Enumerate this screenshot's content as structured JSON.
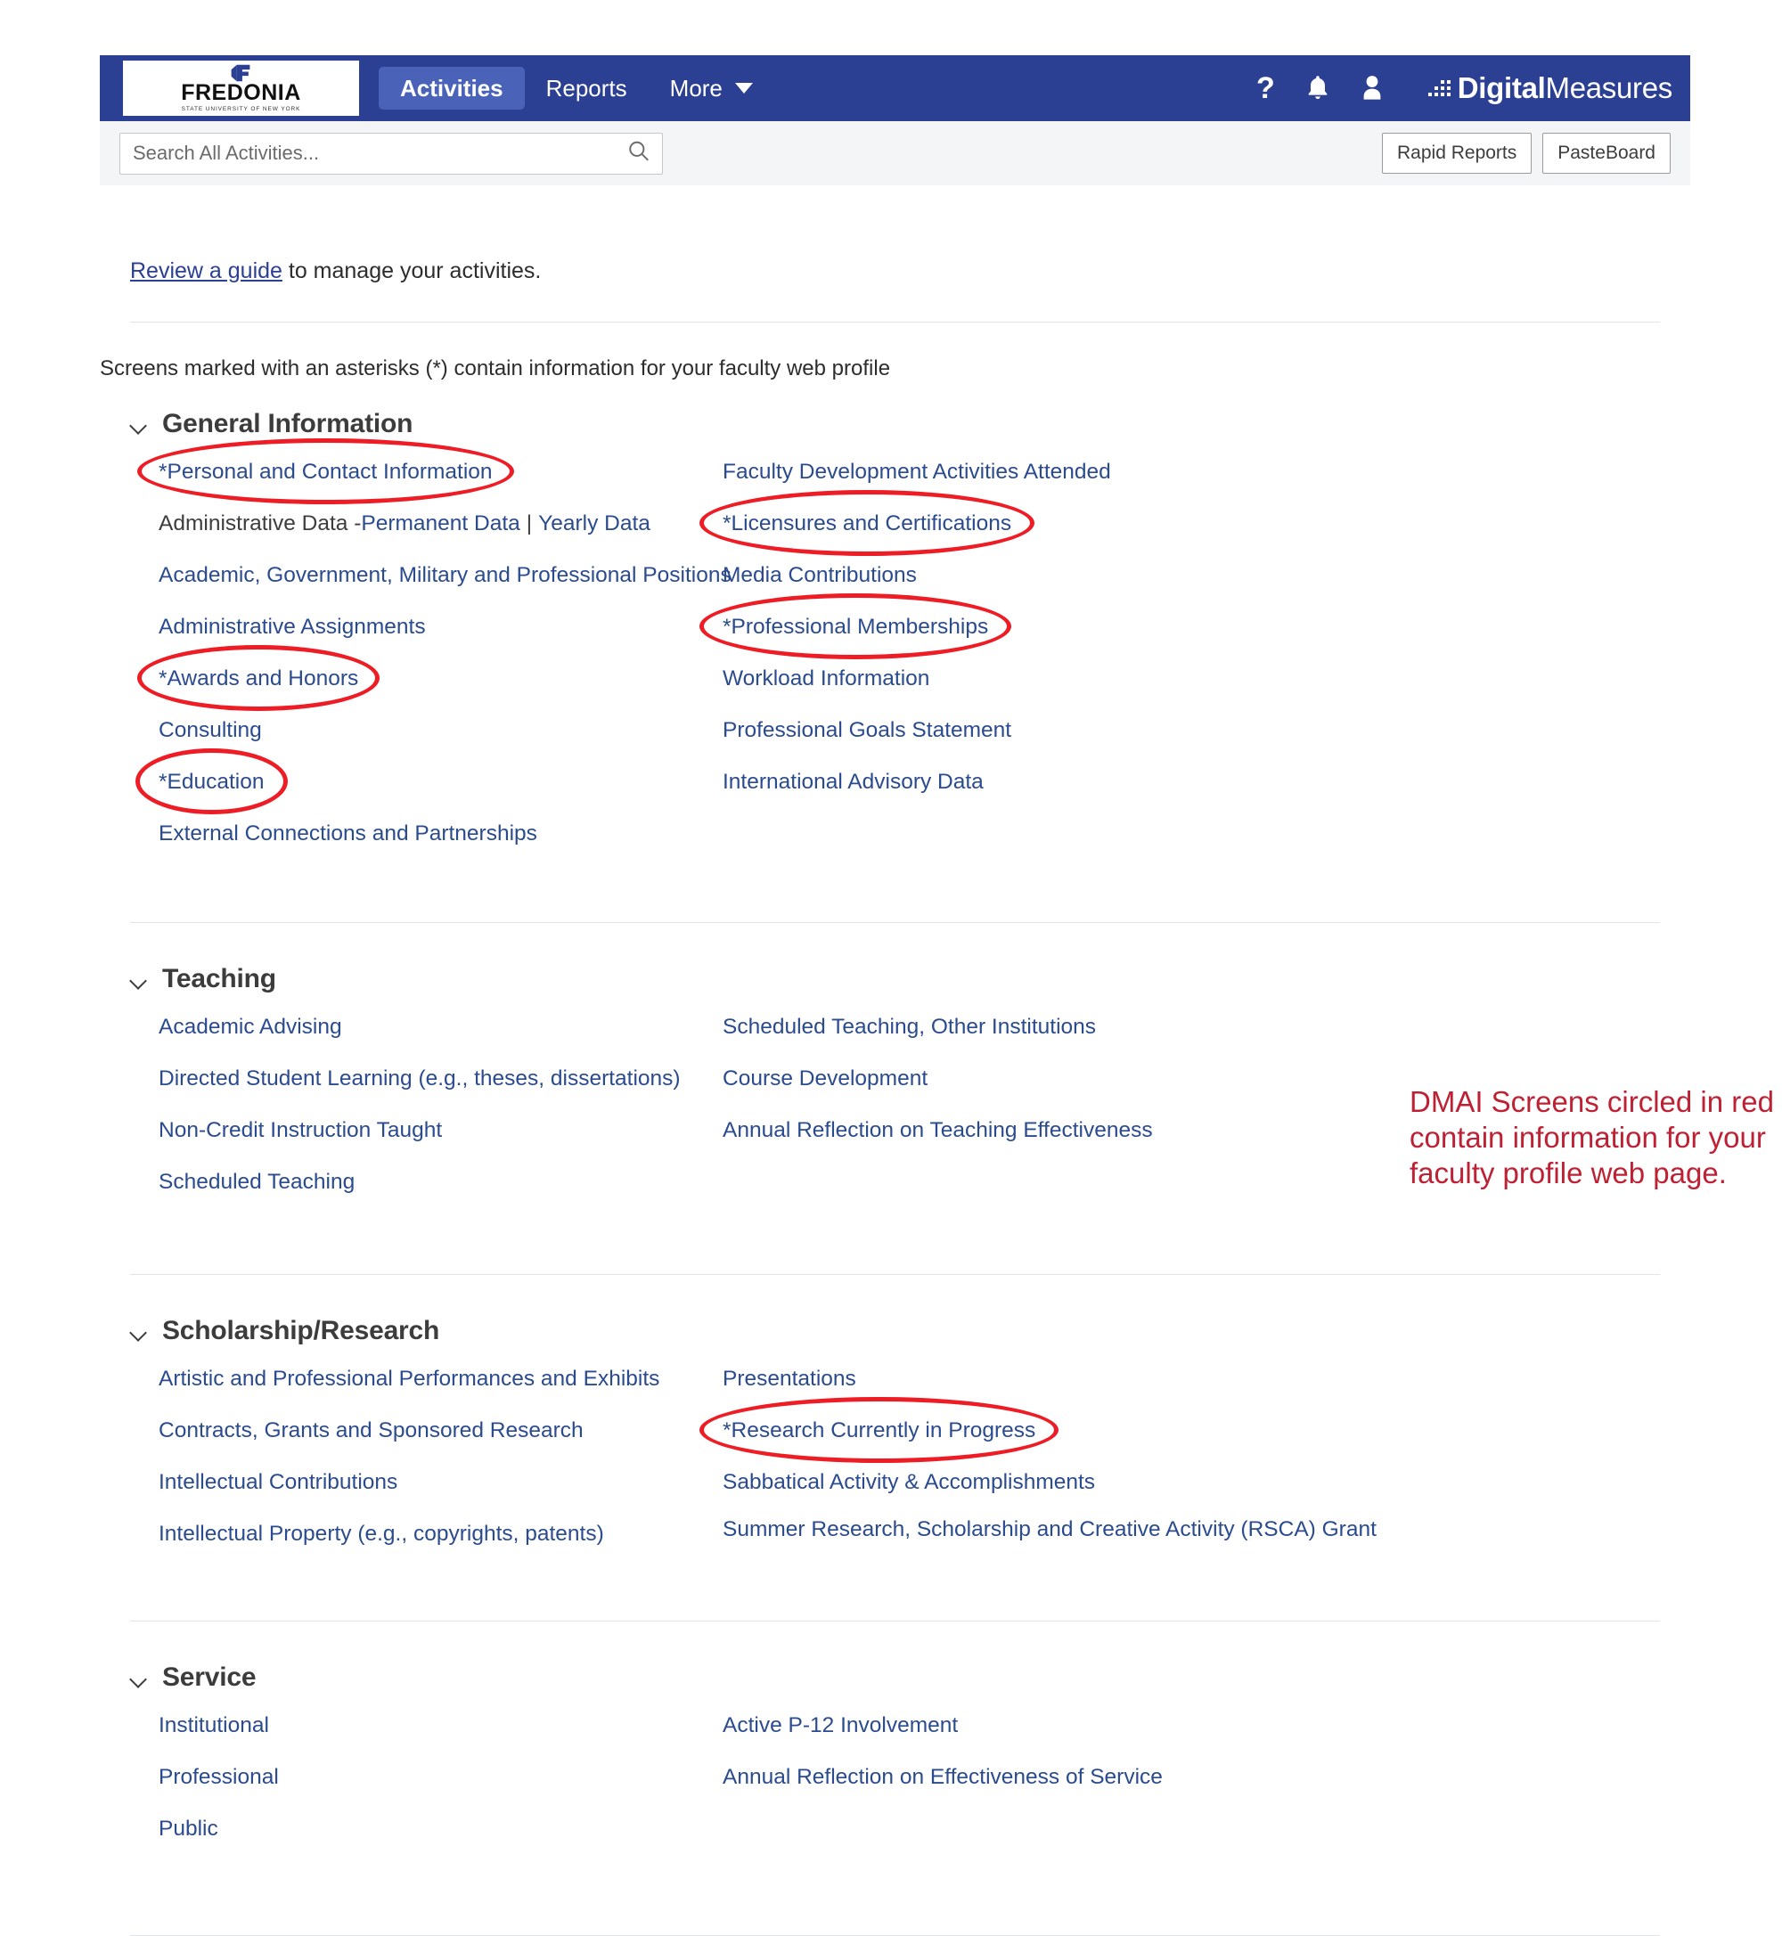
{
  "colors": {
    "nav_blue": "#2b3f93",
    "nav_active": "#4a62b8",
    "link_blue": "#2b4b8f",
    "annotation_red": "#bf2134",
    "oval_red": "#ee1c25"
  },
  "header": {
    "logo": {
      "wordmark": "FREDONIA",
      "subtext": "STATE UNIVERSITY OF NEW YORK"
    },
    "nav": [
      {
        "label": "Activities",
        "active": true
      },
      {
        "label": "Reports",
        "active": false
      },
      {
        "label": "More",
        "active": false,
        "has_caret": true
      }
    ],
    "icons": [
      "help-icon",
      "notifications-bell-icon",
      "user-account-icon"
    ],
    "brand": {
      "dots": "..::",
      "bold": "Digital",
      "light": "Measures"
    }
  },
  "subbar": {
    "search": {
      "placeholder": "Search All Activities...",
      "value": ""
    },
    "buttons": [
      {
        "label": "Rapid Reports"
      },
      {
        "label": "PasteBoard"
      }
    ]
  },
  "intro": {
    "guide_link": "Review a guide",
    "guide_rest": " to manage your activities.",
    "asterisk_note": "Screens marked with an asterisks (*) contain information for your faculty web profile"
  },
  "annotation": {
    "text": "DMAI Screens circled in red contain information for your faculty profile web page."
  },
  "sections": [
    {
      "title": "General Information",
      "left": [
        {
          "label": "*Personal and Contact Information",
          "circled": true
        },
        {
          "prefix": "Administrative Data - ",
          "parts": [
            "Permanent Data",
            "Yearly Data"
          ],
          "separator": "|",
          "type": "split"
        },
        {
          "label": "Academic, Government, Military and Professional Positions"
        },
        {
          "label": "Administrative Assignments"
        },
        {
          "label": "*Awards and Honors",
          "circled": true
        },
        {
          "label": "Consulting"
        },
        {
          "label": "*Education",
          "circled": true
        },
        {
          "label": "External Connections and Partnerships"
        }
      ],
      "right": [
        {
          "label": "Faculty Development Activities Attended"
        },
        {
          "label": "*Licensures and Certifications",
          "circled": true
        },
        {
          "label": "Media Contributions"
        },
        {
          "label": "*Professional Memberships",
          "circled": true
        },
        {
          "label": "Workload Information"
        },
        {
          "label": "Professional Goals Statement"
        },
        {
          "label": "International Advisory Data"
        }
      ]
    },
    {
      "title": "Teaching",
      "left": [
        {
          "label": "Academic Advising"
        },
        {
          "label": "Directed Student Learning (e.g., theses, dissertations)"
        },
        {
          "label": "Non-Credit Instruction Taught"
        },
        {
          "label": "Scheduled Teaching"
        }
      ],
      "right": [
        {
          "label": "Scheduled Teaching, Other Institutions"
        },
        {
          "label": "Course Development"
        },
        {
          "label": "Annual Reflection on Teaching Effectiveness"
        }
      ]
    },
    {
      "title": "Scholarship/Research",
      "left": [
        {
          "label": "Artistic and Professional Performances and Exhibits"
        },
        {
          "label": "Contracts, Grants and Sponsored Research"
        },
        {
          "label": "Intellectual Contributions"
        },
        {
          "label": "Intellectual Property (e.g., copyrights, patents)"
        }
      ],
      "right": [
        {
          "label": "Presentations"
        },
        {
          "label": "*Research Currently in Progress",
          "circled": true
        },
        {
          "label": "Sabbatical Activity & Accomplishments"
        },
        {
          "label": "Summer Research, Scholarship and Creative Activity (RSCA) Grant",
          "wrap": true
        }
      ]
    },
    {
      "title": "Service",
      "left": [
        {
          "label": "Institutional"
        },
        {
          "label": "Professional"
        },
        {
          "label": "Public"
        }
      ],
      "right": [
        {
          "label": "Active P-12 Involvement"
        },
        {
          "label": "Annual Reflection on Effectiveness of Service"
        }
      ]
    }
  ]
}
